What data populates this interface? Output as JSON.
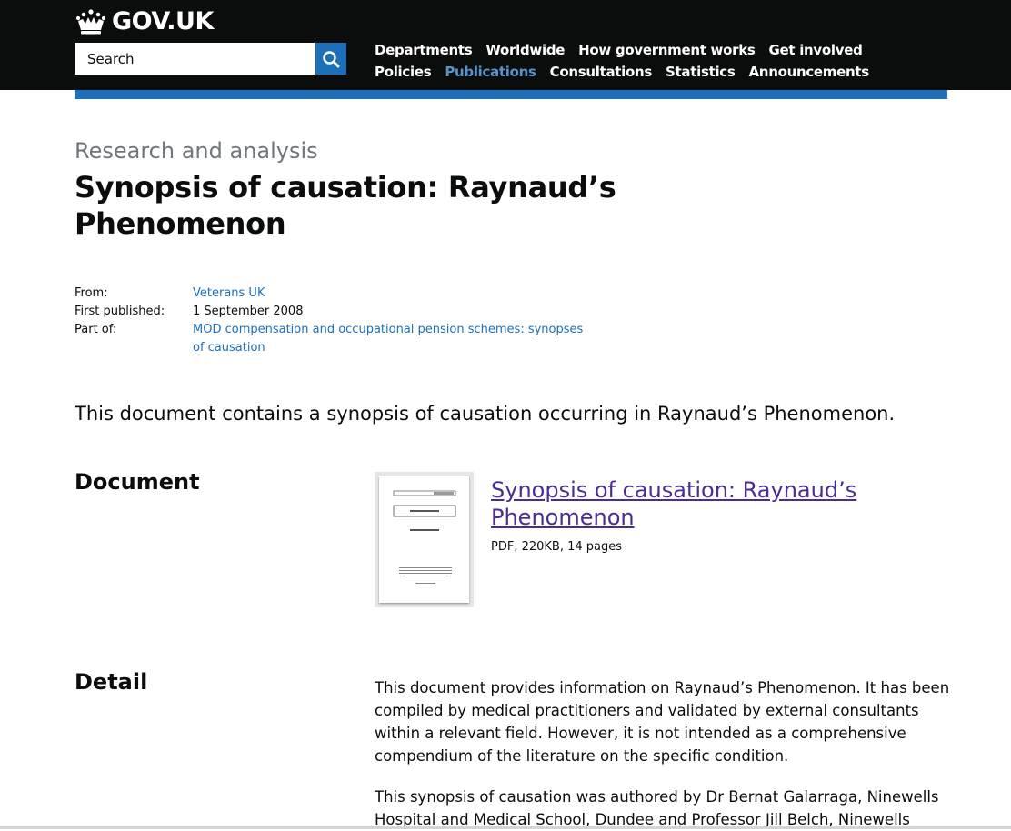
{
  "header": {
    "logo_text": "GOV.UK",
    "search_placeholder": "Search",
    "nav_row1": [
      "Departments",
      "Worldwide",
      "How government works",
      "Get involved"
    ],
    "nav_row2": [
      "Policies",
      "Publications",
      "Consultations",
      "Statistics",
      "Announcements"
    ],
    "active_nav": "Publications"
  },
  "page": {
    "document_type": "Research and analysis",
    "title": "Synopsis of causation: Raynaud’s Phenomenon",
    "metadata": [
      {
        "key": "From:",
        "value": "Veterans UK",
        "is_link": true
      },
      {
        "key": "First published:",
        "value": "1 September 2008",
        "is_link": false
      },
      {
        "key": "Part of:",
        "value": "MOD compensation and occupational pension schemes: synopses of causation",
        "is_link": true
      }
    ],
    "lead": "This document contains a synopsis of causation occurring in Raynaud’s Phenomenon."
  },
  "document_section": {
    "heading": "Document",
    "attachment_title": "Synopsis of causation: Raynaud’s Phenomenon",
    "attachment_meta": "PDF, 220KB, 14 pages"
  },
  "detail_section": {
    "heading": "Detail",
    "paragraphs": [
      "This document provides information on Raynaud’s Phenomenon. It has been compiled by medical practitioners and validated by external consultants within a relevant field. However, it is not intended as a comprehensive compendium of the literature on the specific condition.",
      "This synopsis of causation was authored by Dr Bernat Galarraga, Ninewells Hospital and Medical School, Dundee and Professor Jill Belch, Ninewells"
    ]
  },
  "colors": {
    "header_bg": "#0b0c0c",
    "brand_blue": "#1d70b8",
    "link": "#1d70b8",
    "visited_link": "#4c2c92",
    "secondary_text": "#6f777b"
  }
}
